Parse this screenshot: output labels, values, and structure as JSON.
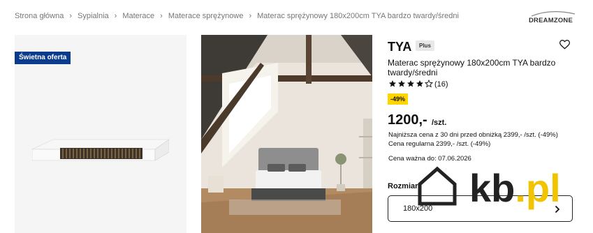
{
  "breadcrumb": [
    "Strona główna",
    "Sypialnia",
    "Materace",
    "Materace sprężynowe",
    "Materac sprężynowy 180x200cm TYA bardzo twardy/średni"
  ],
  "brand": {
    "name": "DREAMZONE"
  },
  "gallery": {
    "deal_badge": "Świetna oferta"
  },
  "product": {
    "title": "TYA",
    "badge": "Plus",
    "name": "Materac sprężynowy 180x200cm TYA bardzo twardy/średni",
    "rating": 4,
    "rating_max": 5,
    "review_count": "(16)",
    "discount": "-49%",
    "price": "1200,-",
    "price_unit": "/szt.",
    "lowest_price_note": "Najniższa cena z 30 dni przed obniżką 2399,- /szt. (-49%)",
    "regular_price_note": "Cena regularna 2399,- /szt. (-49%)",
    "valid_until": "Cena ważna do: 07.06.2026",
    "size_label": "Rozmiar",
    "size_value": "180x200"
  },
  "watermark": {
    "main": "kb",
    "suffix": ".pl"
  },
  "colors": {
    "deal_badge": "#0a3b8c",
    "discount": "#ffd500",
    "watermark_accent": "#f2c400"
  }
}
